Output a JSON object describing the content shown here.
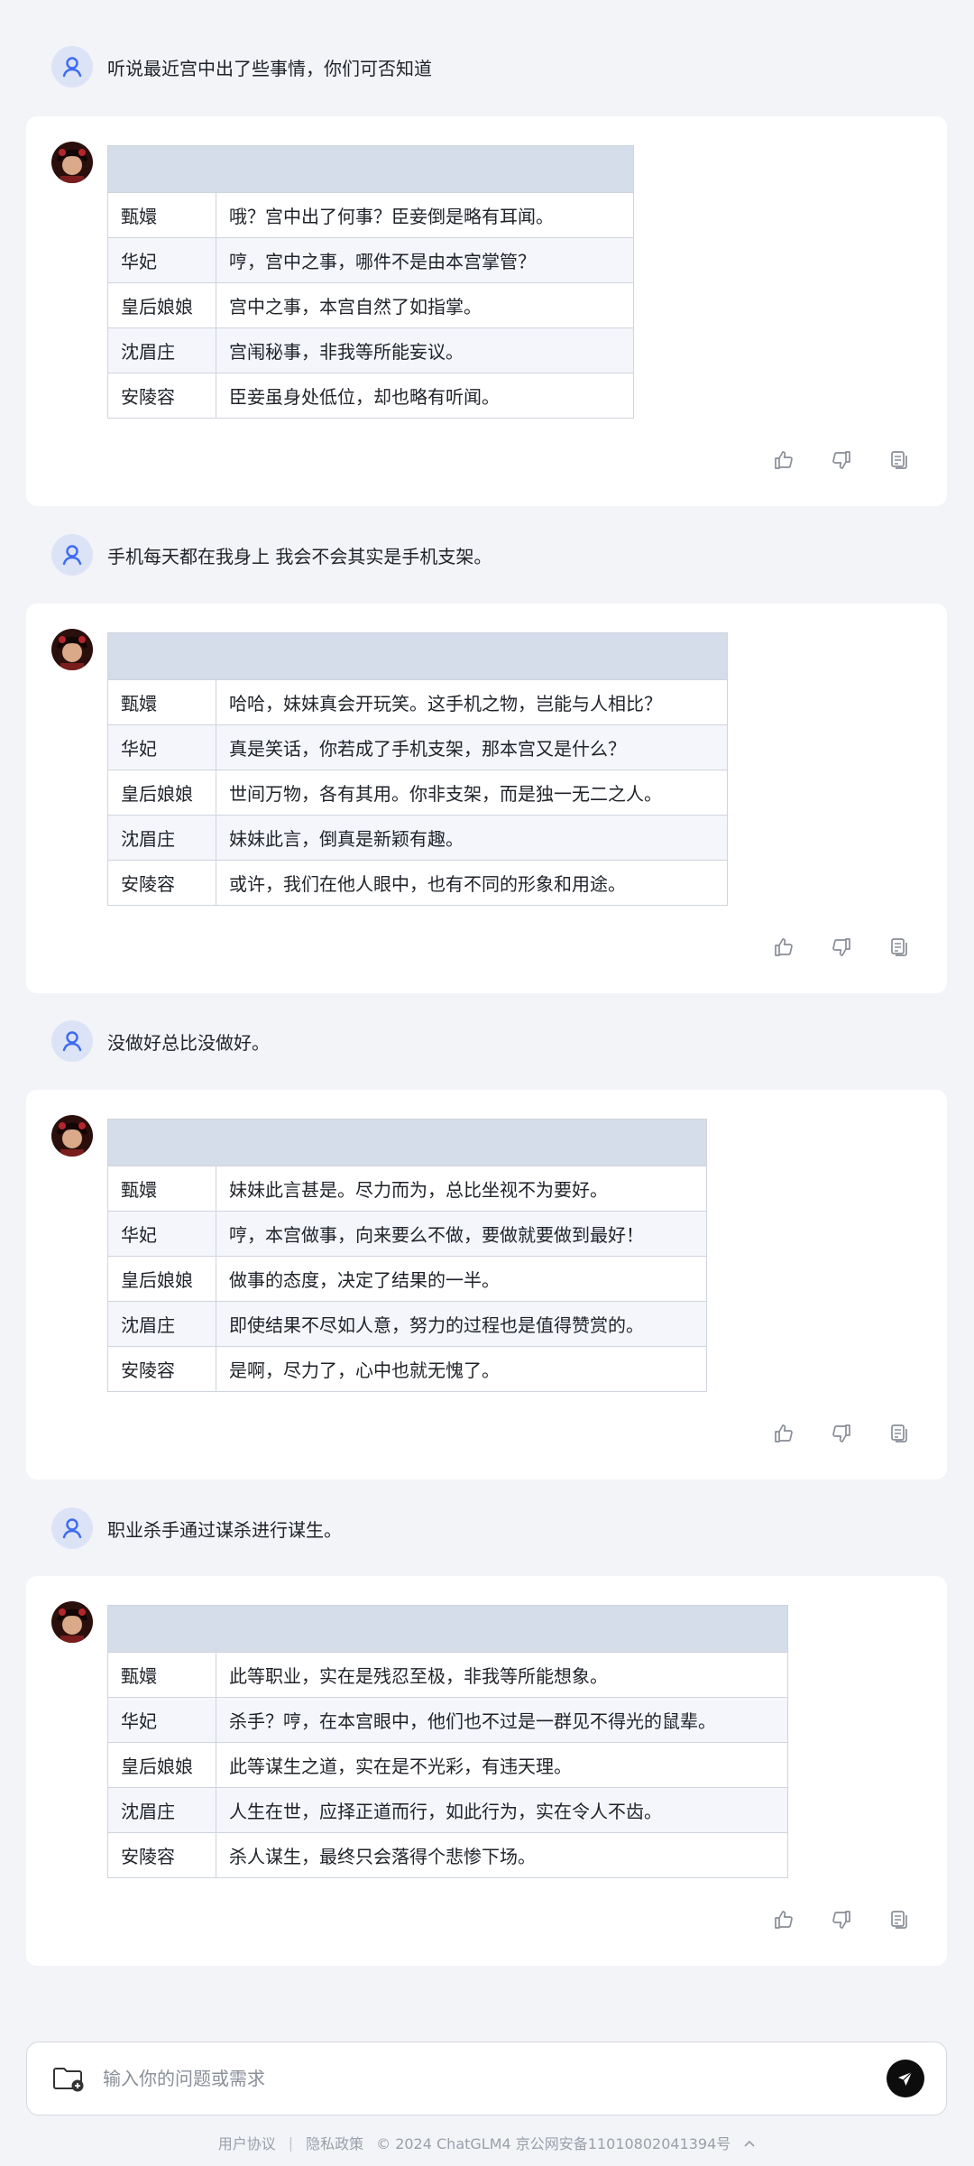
{
  "conversation": [
    {
      "question": "听说最近宫中出了些事情，你们可否知道",
      "rows": [
        {
          "name": "甄嬛",
          "line": "哦？宫中出了何事？臣妾倒是略有耳闻。"
        },
        {
          "name": "华妃",
          "line": "哼，宫中之事，哪件不是由本宫掌管？"
        },
        {
          "name": "皇后娘娘",
          "line": "宫中之事，本宫自然了如指掌。"
        },
        {
          "name": "沈眉庄",
          "line": "宫闱秘事，非我等所能妄议。"
        },
        {
          "name": "安陵容",
          "line": "臣妾虽身处低位，却也略有听闻。"
        }
      ]
    },
    {
      "question": "手机每天都在我身上 我会不会其实是手机支架。",
      "rows": [
        {
          "name": "甄嬛",
          "line": "哈哈，妹妹真会开玩笑。这手机之物，岂能与人相比？"
        },
        {
          "name": "华妃",
          "line": "真是笑话，你若成了手机支架，那本宫又是什么？"
        },
        {
          "name": "皇后娘娘",
          "line": "世间万物，各有其用。你非支架，而是独一无二之人。"
        },
        {
          "name": "沈眉庄",
          "line": "妹妹此言，倒真是新颖有趣。"
        },
        {
          "name": "安陵容",
          "line": "或许，我们在他人眼中，也有不同的形象和用途。"
        }
      ]
    },
    {
      "question": "没做好总比没做好。",
      "rows": [
        {
          "name": "甄嬛",
          "line": "妹妹此言甚是。尽力而为，总比坐视不为要好。"
        },
        {
          "name": "华妃",
          "line": "哼，本宫做事，向来要么不做，要做就要做到最好！"
        },
        {
          "name": "皇后娘娘",
          "line": "做事的态度，决定了结果的一半。"
        },
        {
          "name": "沈眉庄",
          "line": "即使结果不尽如人意，努力的过程也是值得赞赏的。"
        },
        {
          "name": "安陵容",
          "line": "是啊，尽力了，心中也就无愧了。"
        }
      ]
    },
    {
      "question": "职业杀手通过谋杀进行谋生。",
      "rows": [
        {
          "name": "甄嬛",
          "line": "此等职业，实在是残忍至极，非我等所能想象。"
        },
        {
          "name": "华妃",
          "line": "杀手？哼，在本宫眼中，他们也不过是一群见不得光的鼠辈。"
        },
        {
          "name": "皇后娘娘",
          "line": "此等谋生之道，实在是不光彩，有违天理。"
        },
        {
          "name": "沈眉庄",
          "line": "人生在世，应择正道而行，如此行为，实在令人不齿。"
        },
        {
          "name": "安陵容",
          "line": "杀人谋生，最终只会落得个悲惨下场。"
        }
      ]
    }
  ],
  "input": {
    "placeholder": "输入你的问题或需求"
  },
  "footer": {
    "user_agreement": "用户协议",
    "divider": "|",
    "privacy": "隐私政策",
    "copyright": "© 2024 ChatGLM4 京公网安备11010802041394号"
  },
  "icons": {
    "like": "thumbs-up-icon",
    "dislike": "thumbs-down-icon",
    "copy": "copy-icon",
    "upload": "folder-add-icon",
    "send": "send-icon",
    "collapse": "chevron-up-icon"
  },
  "colors": {
    "accent": "#3d6bf0",
    "table_header": "#d5dcea",
    "page_bg": "#f3f4f8"
  }
}
